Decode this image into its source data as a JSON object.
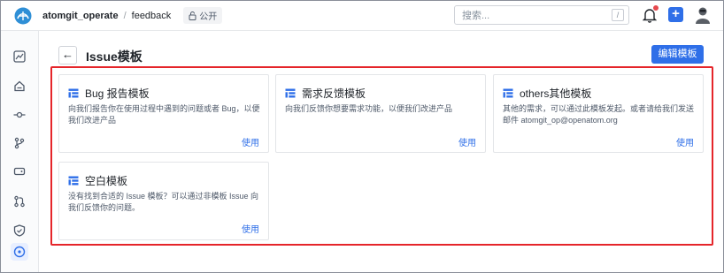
{
  "topbar": {
    "repo": "atomgit_operate",
    "separator": "/",
    "project": "feedback",
    "visibility": "公开",
    "search_placeholder": "搜索...",
    "search_shortcut": "/",
    "icons": [
      "atomgit-logo-icon",
      "lock-open-icon",
      "bell-icon",
      "plus-icon",
      "avatar-icon"
    ]
  },
  "sidebar": {
    "items": [
      {
        "name": "overview",
        "icon": "dashboard-icon"
      },
      {
        "name": "home",
        "icon": "home-icon"
      },
      {
        "name": "commits",
        "icon": "commit-icon"
      },
      {
        "name": "branches",
        "icon": "branch-icon"
      },
      {
        "name": "tags",
        "icon": "tag-icon"
      },
      {
        "name": "pull-requests",
        "icon": "pull-request-icon"
      },
      {
        "name": "security",
        "icon": "shield-icon"
      },
      {
        "name": "issues",
        "icon": "issue-icon",
        "active": true
      }
    ]
  },
  "header": {
    "title": "Issue模板",
    "edit_button": "编辑模板"
  },
  "templates": [
    {
      "title": "Bug 报告模板",
      "desc": "向我们报告你在使用过程中遇到的问题或者 Bug，以便我们改进产品",
      "use": "使用"
    },
    {
      "title": "需求反馈模板",
      "desc": "向我们反馈你想要需求功能，以便我们改进产品",
      "use": "使用"
    },
    {
      "title": "others其他模板",
      "desc": "其他的需求，可以通过此模板发起。或者请给我们发送邮件 atomgit_op@openatom.org",
      "use": "使用"
    },
    {
      "title": "空白模板",
      "desc": "没有找到合适的 Issue 模板？可以通过非模板 Issue 向我们反馈你的问题。",
      "use": "使用"
    }
  ],
  "colors": {
    "accent": "#2f6fe8",
    "highlight": "#e5252a"
  }
}
